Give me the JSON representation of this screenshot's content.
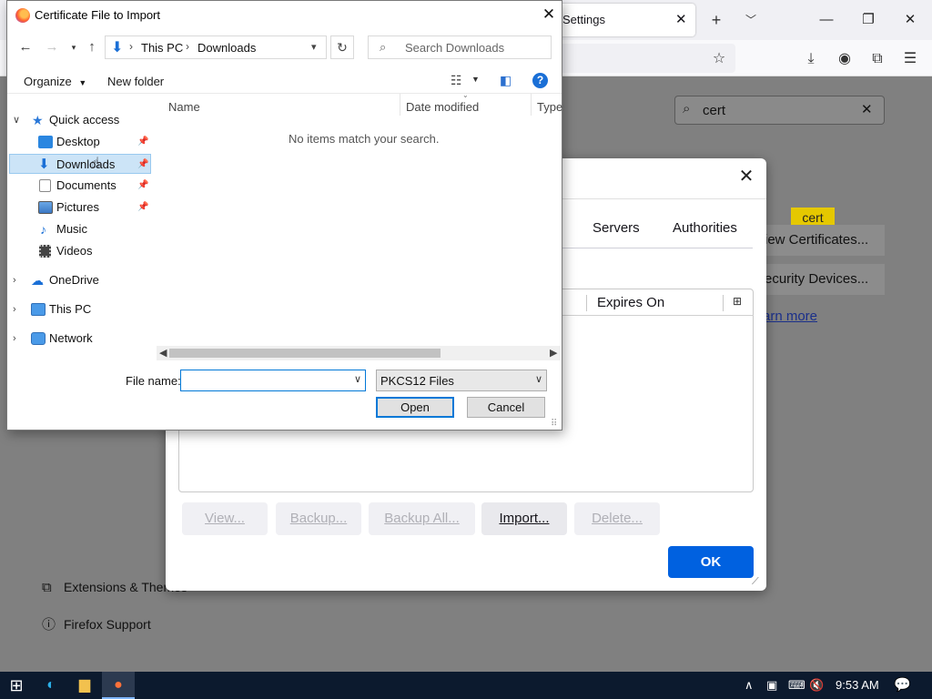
{
  "firefox": {
    "tab_title": "Settings",
    "search_value": "cert",
    "highlight_tooltip": "cert",
    "view_certificates": "iew Certificates...",
    "security_devices": "ecurity Devices...",
    "learn_more": "arn more",
    "footer": {
      "extensions": "Extensions & Themes",
      "support": "Firefox Support"
    }
  },
  "cert_manager": {
    "tabs": [
      "Servers",
      "Authorities"
    ],
    "column_expires": "Expires On",
    "buttons": {
      "view": "View...",
      "backup": "Backup...",
      "backup_all": "Backup All...",
      "import": "Import...",
      "delete": "Delete...",
      "ok": "OK"
    }
  },
  "file_dialog": {
    "title": "Certificate File to Import",
    "breadcrumb": [
      "This PC",
      "Downloads"
    ],
    "search_placeholder": "Search Downloads",
    "toolbar": {
      "organize": "Organize",
      "new_folder": "New folder"
    },
    "nav_pane": {
      "quick_access": "Quick access",
      "quick_items": [
        {
          "label": "Desktop",
          "pinned": true
        },
        {
          "label": "Downloads",
          "pinned": true,
          "selected": true
        },
        {
          "label": "Documents",
          "pinned": true
        },
        {
          "label": "Pictures",
          "pinned": true
        },
        {
          "label": "Music",
          "pinned": false
        },
        {
          "label": "Videos",
          "pinned": false
        }
      ],
      "roots": [
        "OneDrive",
        "This PC",
        "Network"
      ]
    },
    "columns": [
      "Name",
      "Date modified",
      "Type"
    ],
    "empty_message": "No items match your search.",
    "file_name_label": "File name:",
    "file_name_value": "",
    "file_type": "PKCS12 Files",
    "buttons": {
      "open": "Open",
      "cancel": "Cancel"
    }
  },
  "taskbar": {
    "time": "9:53 AM"
  },
  "colors": {
    "ok_button": "#0061e0",
    "selection": "#cce4f7",
    "focus_border": "#0078d7",
    "taskbar": "#0c1a2e"
  }
}
